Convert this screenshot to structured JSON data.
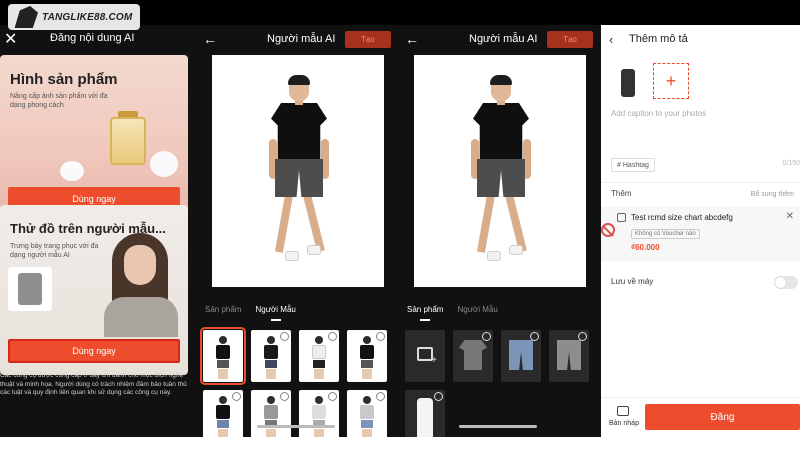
{
  "logo": {
    "text": "TANGLIKE88.COM"
  },
  "panel1": {
    "title": "Đăng nội dung AI",
    "card1": {
      "title": "Hình sản phẩm",
      "subtitle": "Nâng cấp ảnh sản phẩm với đa dạng phong cách",
      "button": "Dùng ngay"
    },
    "card2": {
      "title": "Thử đồ trên người mẫu...",
      "subtitle": "Trưng bày trang phục với đa dạng người mẫu AI",
      "button": "Dùng ngay"
    },
    "disclaimer": "Các công cụ được cung cấp ở đây chỉ dành cho mục đích nghệ thuật và minh họa. Người dùng có trách nhiệm đảm bảo tuân thủ các luật và quy định liên quan khi sử dụng các công cụ này."
  },
  "panel2": {
    "title": "Người mẫu AI",
    "create": "Tạo",
    "tabs": [
      "Sản phẩm",
      "Người Mẫu"
    ],
    "active_tab": 1
  },
  "panel3": {
    "title": "Người mẫu AI",
    "create": "Tạo",
    "tabs": [
      "Sản phẩm",
      "Người Mẫu"
    ],
    "active_tab": 0
  },
  "panel4": {
    "title": "Thêm mô tả",
    "caption_placeholder": "Add caption to your photos",
    "hashtag": "# Hashtag",
    "char_count": "0/150",
    "more_label": "Thêm",
    "more_action": "Bổ sung thêm",
    "product_name": "Test rcmd size chart abcdefg",
    "voucher": "Không có Voucher nào",
    "price": "₫60.000",
    "save_label": "Lưu về máy",
    "draft": "Bản nháp",
    "post": "Đăng"
  },
  "colors": {
    "accent": "#ee4d2d",
    "dark_bg": "#111111"
  }
}
